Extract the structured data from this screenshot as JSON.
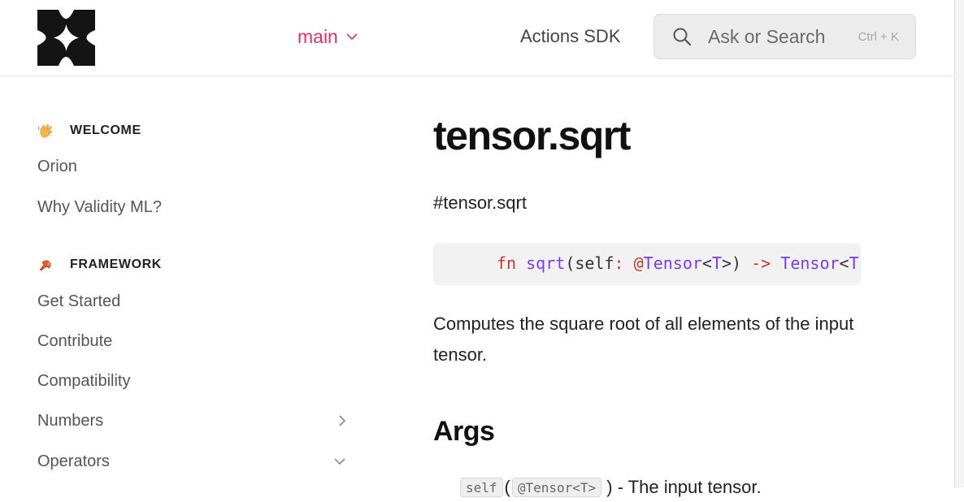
{
  "header": {
    "version_label": "main",
    "nav_link": "Actions SDK",
    "search_placeholder": "Ask or Search",
    "search_shortcut": "Ctrl + K"
  },
  "sidebar": {
    "sections": [
      {
        "title": "WELCOME",
        "icon": "waving-hand-icon",
        "items": [
          {
            "label": "Orion"
          },
          {
            "label": "Why Validity ML?"
          }
        ]
      },
      {
        "title": "FRAMEWORK",
        "icon": "pushpin-icon",
        "items": [
          {
            "label": "Get Started"
          },
          {
            "label": "Contribute"
          },
          {
            "label": "Compatibility"
          },
          {
            "label": "Numbers",
            "chevron": "chevron-right-icon"
          },
          {
            "label": "Operators",
            "chevron": "chevron-down-icon"
          }
        ]
      }
    ]
  },
  "content": {
    "title": "tensor.sqrt",
    "anchor": "#tensor.sqrt",
    "code": {
      "kw": "fn",
      "name": "sqrt",
      "open": "(self",
      "colon": ":",
      "at_type": "@Tensor",
      "lt": "<",
      "tparam": "T",
      "gt_close": ">)",
      "arrow": "->",
      "ret_type": "Tensor",
      "lt2": "<",
      "tparam2": "T"
    },
    "description": "Computes the square root of all elements of the input tensor.",
    "args_heading": "Args",
    "arg_chip_1": "self",
    "arg_sep": "(",
    "arg_chip_2": "@Tensor<T>",
    "arg_text": ") - The input tensor."
  },
  "colors": {
    "accent": "#d6336c",
    "keyword": "#c0392b",
    "type": "#7c3aed"
  }
}
